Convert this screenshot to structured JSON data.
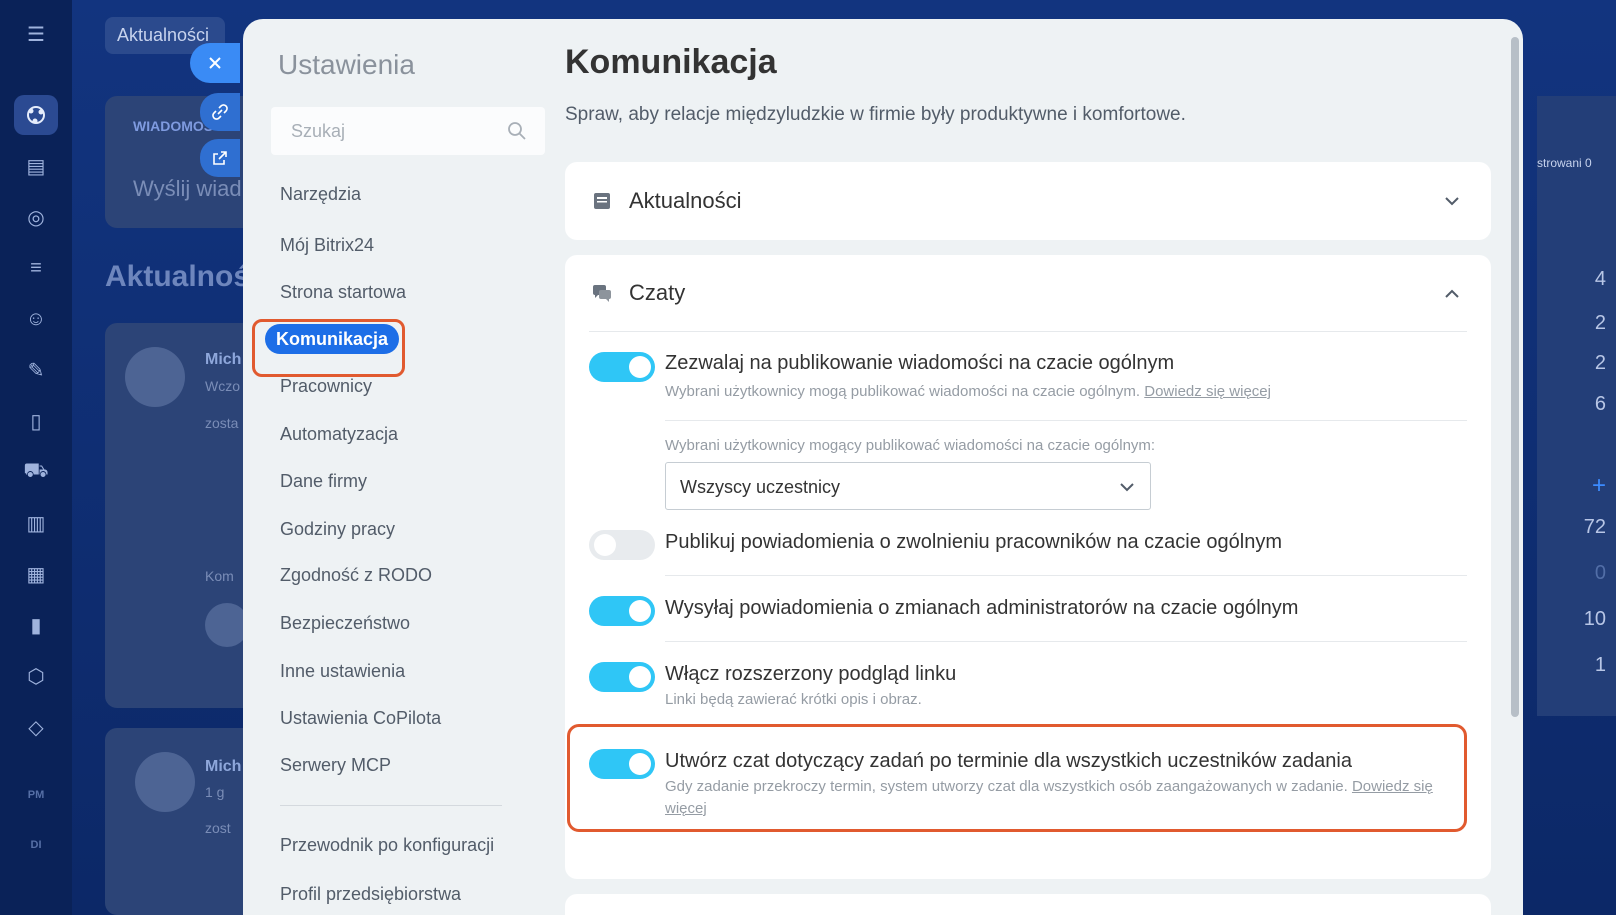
{
  "background": {
    "tab_label": "Aktualności",
    "messages_tab": "WIADOMOŚ",
    "send_message_text": "Wyślij wiad",
    "feed_title": "Aktualnoś",
    "post_author": "Mich",
    "post_subtitle": "Wczo",
    "post_snippet": "zosta",
    "comment_label": "Kom",
    "post2_author": "Mich",
    "post2_time": "1 g",
    "post2_snippet": "zost",
    "right_panel": {
      "filtered_label": "strowani 0",
      "numbers": [
        "4",
        "2",
        "2",
        "6",
        "72",
        "0",
        "10",
        "1"
      ],
      "plus": "+"
    },
    "rail_icons": [
      "menu-icon",
      "feed-icon",
      "contacts-icon",
      "target-icon",
      "funnel-icon",
      "robot-icon",
      "pen-icon",
      "document-icon",
      "cart-icon",
      "building-icon",
      "calendar-icon",
      "chart-icon",
      "hexagon-icon",
      "box-icon"
    ],
    "rail_small": [
      "PM",
      "DI"
    ]
  },
  "settings": {
    "title": "Ustawienia",
    "search_placeholder": "Szukaj",
    "nav": [
      {
        "label": "Narzędzia"
      },
      {
        "label": "Mój Bitrix24"
      },
      {
        "label": "Strona startowa"
      },
      {
        "label": "Komunikacja",
        "active": true
      },
      {
        "label": "Pracownicy"
      },
      {
        "label": "Automatyzacja"
      },
      {
        "label": "Dane firmy"
      },
      {
        "label": "Godziny pracy"
      },
      {
        "label": "Zgodność z RODO"
      },
      {
        "label": "Bezpieczeństwo"
      },
      {
        "label": "Inne ustawienia"
      },
      {
        "label": "Ustawienia CoPilota"
      },
      {
        "label": "Serwery MCP"
      }
    ],
    "nav_footer": "Przewodnik po konfiguracji",
    "nav_footer2": "Profil przedsiębiorstwa"
  },
  "content": {
    "title": "Komunikacja",
    "subtitle": "Spraw, aby relacje międzyludzkie w firmie były produktywne i komfortowe.",
    "sections": {
      "news": {
        "title": "Aktualności",
        "expanded": false
      },
      "chats": {
        "title": "Czaty",
        "expanded": true,
        "options": [
          {
            "label": "Zezwalaj na publikowanie wiadomości na czacie ogólnym",
            "on": true,
            "desc": "Wybrani użytkownicy mogą publikować wiadomości na czacie ogólnym.",
            "link": "Dowiedz się więcej"
          },
          {
            "label": "Publikuj powiadomienia o zwolnieniu pracowników na czacie ogólnym",
            "on": false
          },
          {
            "label": "Wysyłaj powiadomienia o zmianach administratorów na czacie ogólnym",
            "on": true
          },
          {
            "label": "Włącz rozszerzony podgląd linku",
            "on": true,
            "desc": "Linki będą zawierać krótki opis i obraz."
          },
          {
            "label": "Utwórz czat dotyczący zadań po terminie dla wszystkich uczestników zadania",
            "on": true,
            "desc": "Gdy zadanie przekroczy termin, system utworzy czat dla wszystkich osób zaangażowanych w zadanie.",
            "link": "Dowiedz się więcej"
          }
        ],
        "select": {
          "label": "Wybrani użytkownicy mogący publikować wiadomości na czacie ogólnym:",
          "value": "Wszyscy uczestnicy"
        }
      }
    }
  },
  "colors": {
    "accent": "#1d6ee7",
    "toggle_on": "#2fc6f6",
    "highlight": "#e15a2f"
  }
}
